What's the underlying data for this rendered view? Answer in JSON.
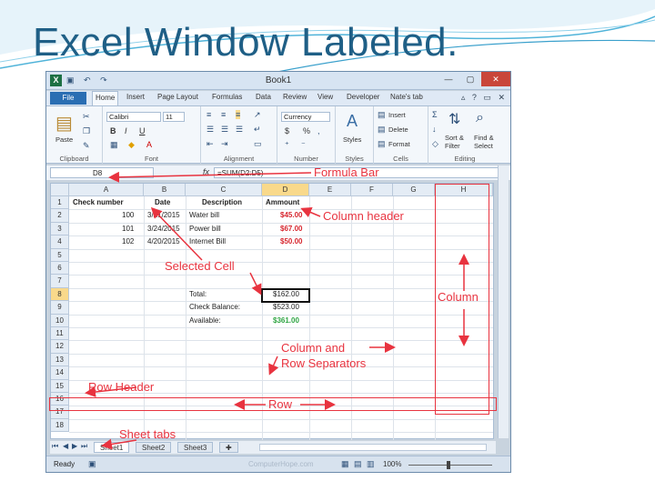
{
  "slide": {
    "title": "Excel Window Labeled."
  },
  "excel": {
    "window_title": "Book1",
    "qat": {
      "save": "▣",
      "undo": "↶",
      "redo": "↷"
    },
    "window_buttons": {
      "minimize": "—",
      "restore": "▢",
      "close": "✕"
    },
    "file_tab": "File",
    "ribbon_tabs": [
      "Home",
      "Insert",
      "Page Layout",
      "Formulas",
      "Data",
      "Review",
      "View",
      "Developer",
      "Nate's tab"
    ],
    "ribbon": {
      "clipboard": {
        "label": "Clipboard",
        "paste": "Paste"
      },
      "font": {
        "label": "Font",
        "font_name": "Calibri",
        "font_size": "11",
        "bold": "B",
        "italic": "I",
        "underline": "U"
      },
      "alignment": {
        "label": "Alignment"
      },
      "number": {
        "label": "Number",
        "format": "Currency",
        "currency": "$",
        "percent": "%"
      },
      "styles": {
        "label": "Styles",
        "styles_btn": "Styles"
      },
      "cells": {
        "label": "Cells",
        "insert": "Insert",
        "delete": "Delete",
        "format": "Format"
      },
      "editing": {
        "label": "Editing",
        "sort_filter": "Sort & Filter",
        "find_select": "Find & Select"
      }
    },
    "name_box": "D8",
    "fx_label": "fx",
    "formula": "=SUM(D2:D5)",
    "columns": [
      "A",
      "B",
      "C",
      "D",
      "E",
      "F",
      "G",
      "H"
    ],
    "rows": [
      "1",
      "2",
      "3",
      "4",
      "5",
      "6",
      "7",
      "8",
      "9",
      "10",
      "11",
      "12",
      "13",
      "14",
      "15",
      "16",
      "17",
      "18"
    ],
    "headers": {
      "check_number": "Check number",
      "date": "Date",
      "description": "Description",
      "amount": "Ammount"
    },
    "data_rows": [
      {
        "check": "100",
        "date": "3/21/2015",
        "desc": "Water bill",
        "amount": "$45.00"
      },
      {
        "check": "101",
        "date": "3/24/2015",
        "desc": "Power bill",
        "amount": "$67.00"
      },
      {
        "check": "102",
        "date": "4/20/2015",
        "desc": "Internet Bill",
        "amount": "$50.00"
      }
    ],
    "summary": {
      "total_label": "Total:",
      "total_value": "$162.00",
      "balance_label": "Check Balance:",
      "balance_value": "$523.00",
      "available_label": "Available:",
      "available_value": "$361.00"
    },
    "sheets": [
      "Sheet1",
      "Sheet2",
      "Sheet3"
    ],
    "status": {
      "ready": "Ready",
      "watermark": "ComputerHope.com",
      "zoom": "100%"
    }
  },
  "annotations": {
    "formula_bar": "Formula Bar",
    "column_header": "Column header",
    "selected_cell": "Selected Cell",
    "column": "Column",
    "separators_line1": "Column and",
    "separators_line2": "Row Separators",
    "row_header": "Row Header",
    "row": "Row",
    "sheet_tabs": "Sheet tabs"
  },
  "colors": {
    "title": "#1f5f86",
    "annotation": "#e8333f",
    "selected_header": "#f9d98b",
    "amount_red": "#d7272f",
    "available_green": "#2fa543"
  }
}
